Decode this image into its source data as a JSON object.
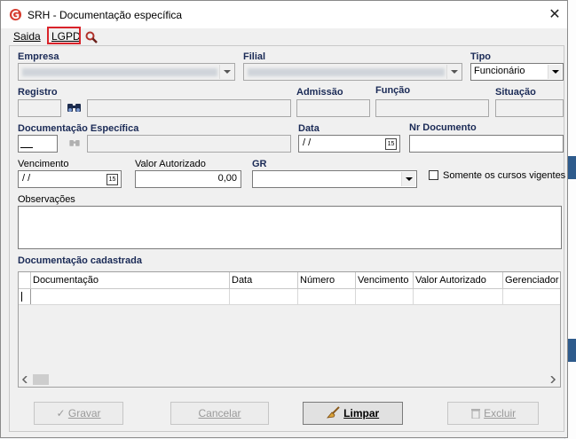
{
  "window": {
    "title": "SRH - Documentação específica",
    "close_icon": "close-icon"
  },
  "menu": {
    "saida": "Saida",
    "lgpd": "LGPD"
  },
  "labels": {
    "empresa": "Empresa",
    "filial": "Filial",
    "tipo": "Tipo",
    "registro": "Registro",
    "admissao": "Admissão",
    "funcao": "Função",
    "situacao": "Situação",
    "documentacao_especifica": "Documentação Específica",
    "data": "Data",
    "nr_documento": "Nr Documento",
    "vencimento": "Vencimento",
    "valor_autorizado": "Valor Autorizado",
    "gr": "GR",
    "somente_cursos": "Somente os cursos vigentes",
    "observacoes": "Observações",
    "documentacao_cadastrada": "Documentação cadastrada"
  },
  "fields": {
    "tipo_value": "Funcionário",
    "data_value": " / /",
    "vencimento_value": " / /",
    "valor_autorizado_value": "0,00",
    "cal_glyph": "15"
  },
  "grid": {
    "columns": [
      "Documentação",
      "Data",
      "Número",
      "Vencimento",
      "Valor Autorizado",
      "Gerenciador"
    ]
  },
  "buttons": {
    "gravar": "Gravar",
    "cancelar": "Cancelar",
    "limpar": "Limpar",
    "excluir": "Excluir"
  },
  "colors": {
    "accent_label": "#1a2a56",
    "highlight_box": "#d9232a",
    "app_icon": "#d63c2f"
  }
}
